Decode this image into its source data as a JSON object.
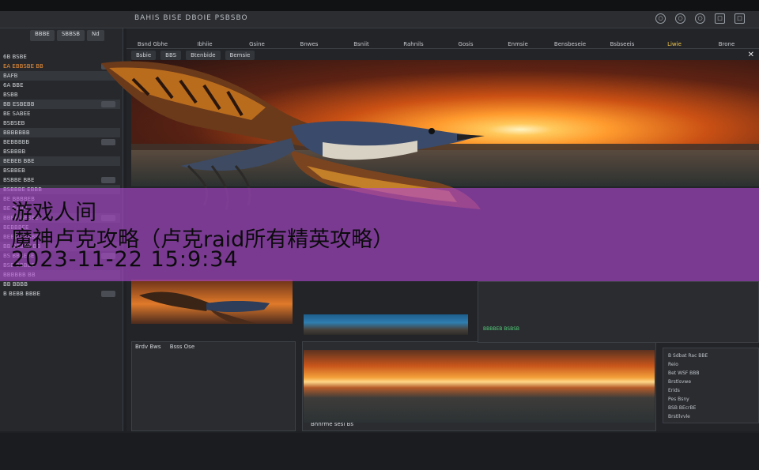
{
  "window": {
    "title": "BAHIS BISE DBOIE PSBSBO",
    "controls": [
      "○",
      "○",
      "○",
      "□",
      "□"
    ]
  },
  "sidebar": {
    "tabs": [
      "BBBE",
      "SBBSB",
      "Nd"
    ],
    "rows": [
      {
        "label": "6B BSBE",
        "hl": false
      },
      {
        "label": "EA EBBSBE BB",
        "hl": true
      },
      {
        "label": "BAFB",
        "hl": false
      },
      {
        "label": "6A BBE",
        "hl": false
      },
      {
        "label": "BSBB",
        "hl": false
      },
      {
        "label": "BB ESBEBB",
        "hl": false
      },
      {
        "label": "BE SABEE",
        "hl": false
      },
      {
        "label": "BSBSEB",
        "hl": false
      },
      {
        "label": "BBBBBBB",
        "hl": false
      },
      {
        "label": "BEBBBBB",
        "hl": false
      },
      {
        "label": "BSBBBB",
        "hl": false
      },
      {
        "label": "BEBEB BBE",
        "hl": false
      },
      {
        "label": "BSBBEB",
        "hl": false
      },
      {
        "label": "BSBBE BBE",
        "hl": false
      },
      {
        "label": "BSBBBE EBBB",
        "hl": false
      },
      {
        "label": "BE BBBBEB",
        "hl": false
      },
      {
        "label": "BE BBBB",
        "hl": false
      },
      {
        "label": "BBBB BEBBE",
        "hl": false
      },
      {
        "label": "BEBBBEE",
        "hl": false
      },
      {
        "label": "BEBBB BBBB",
        "hl": false
      },
      {
        "label": "BB BEBBB BB",
        "hl": false
      },
      {
        "label": "BS BBBEBE",
        "hl": false
      },
      {
        "label": "BSB BBBBE",
        "hl": false
      },
      {
        "label": "BBBBBB BB",
        "hl": false
      },
      {
        "label": "BB BBBB",
        "hl": false
      },
      {
        "label": "B BEBB BBBE",
        "hl": false
      }
    ]
  },
  "menubar": {
    "items": [
      "Bsnd Gbhe",
      "Ibhiie",
      "Gsine",
      "Bnwes",
      "Bsniit",
      "Rahnils",
      "Gosis",
      "Enmsie",
      "Bensbeseie",
      "Bsbseeis",
      "Liwie",
      "Brone"
    ],
    "active_index": 10
  },
  "subtabs": [
    "Bsbie",
    "BBS",
    "Btenbide",
    "Bemsie"
  ],
  "overlay": {
    "line1": "游戏人间",
    "line2": "魔神卢克攻略（卢克raid所有精英攻略）",
    "line3": "2023-11-22 15:9:34"
  },
  "panels": {
    "left_lower_tabs": [
      "Brdv Bws",
      "Bsss Ose"
    ],
    "mid_caption": "Bhnrme sesl Bs",
    "bottom_right_caption": "BBBBEB BSBSB",
    "right_list": [
      "B Sdbat Rac BBE",
      "Reio",
      "Bet WSF BBB",
      "Brstlsvwe",
      "Erids",
      "Pes Bsny",
      "BSB BEcrBE",
      "Brstllvvle"
    ]
  },
  "colors": {
    "overlay": "#b048d4",
    "accent": "#f0923a",
    "highlight": "#f2c84b"
  }
}
